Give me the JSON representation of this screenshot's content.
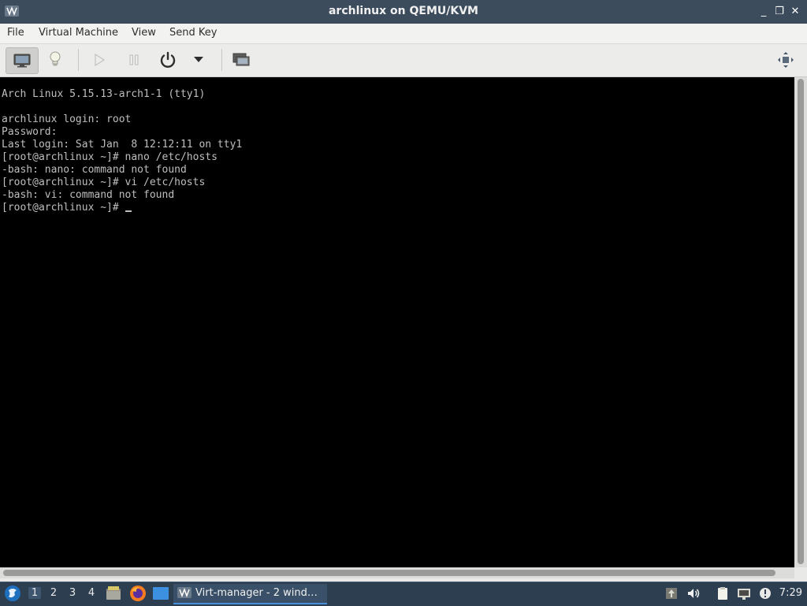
{
  "window": {
    "title": "archlinux on QEMU/KVM",
    "controls": {
      "minimize": "_",
      "restore": "❐",
      "close": "✕"
    }
  },
  "menubar": {
    "items": [
      {
        "label": "File"
      },
      {
        "label": "Virtual Machine"
      },
      {
        "label": "View"
      },
      {
        "label": "Send Key"
      }
    ]
  },
  "toolbar": {
    "buttons": [
      {
        "icon": "monitor-icon",
        "active": true
      },
      {
        "icon": "lightbulb-icon",
        "active": false
      },
      {
        "icon": "play-icon",
        "enabled": false
      },
      {
        "icon": "pause-icon",
        "enabled": false
      },
      {
        "icon": "power-icon",
        "enabled": true
      },
      {
        "icon": "dropdown-arrow-icon",
        "enabled": true
      },
      {
        "icon": "snapshots-icon",
        "enabled": true
      },
      {
        "icon": "fullscreen-icon",
        "enabled": true
      }
    ]
  },
  "console": {
    "lines": [
      "Arch Linux 5.15.13-arch1-1 (tty1)",
      "",
      "archlinux login: root",
      "Password:",
      "Last login: Sat Jan  8 12:12:11 on tty1",
      "[root@archlinux ~]# nano /etc/hosts",
      "-bash: nano: command not found",
      "[root@archlinux ~]# vi /etc/hosts",
      "-bash: vi: command not found"
    ],
    "prompt": "[root@archlinux ~]# "
  },
  "taskbar": {
    "workspaces": [
      "1",
      "2",
      "3",
      "4"
    ],
    "active_workspace": "1",
    "task_label": "Virt-manager - 2 wind…",
    "clock": "7:29"
  },
  "colors": {
    "titlebar": "#3d4c5c",
    "taskbar": "#2c3e50",
    "console_bg": "#000000",
    "console_fg": "#bfbfbf",
    "accent": "#4a90d9"
  }
}
